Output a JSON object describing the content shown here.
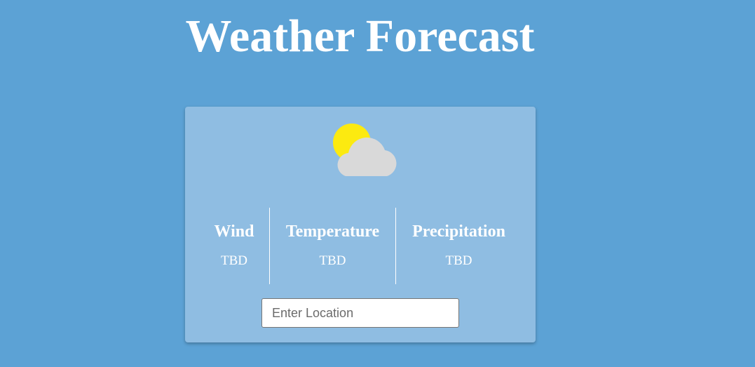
{
  "page": {
    "title": "Weather Forecast",
    "background_color": "#5ca2d5"
  },
  "card": {
    "background_color": "#8fbde2",
    "icon": "partly-cloudy-icon",
    "stats": [
      {
        "label": "Wind",
        "value": "TBD"
      },
      {
        "label": "Temperature",
        "value": "TBD"
      },
      {
        "label": "Precipitation",
        "value": "TBD"
      }
    ],
    "location_input": {
      "placeholder": "Enter Location",
      "value": ""
    }
  },
  "colors": {
    "sun": "#fcea10",
    "cloud": "#d9d9d9",
    "text": "#ffffff"
  }
}
